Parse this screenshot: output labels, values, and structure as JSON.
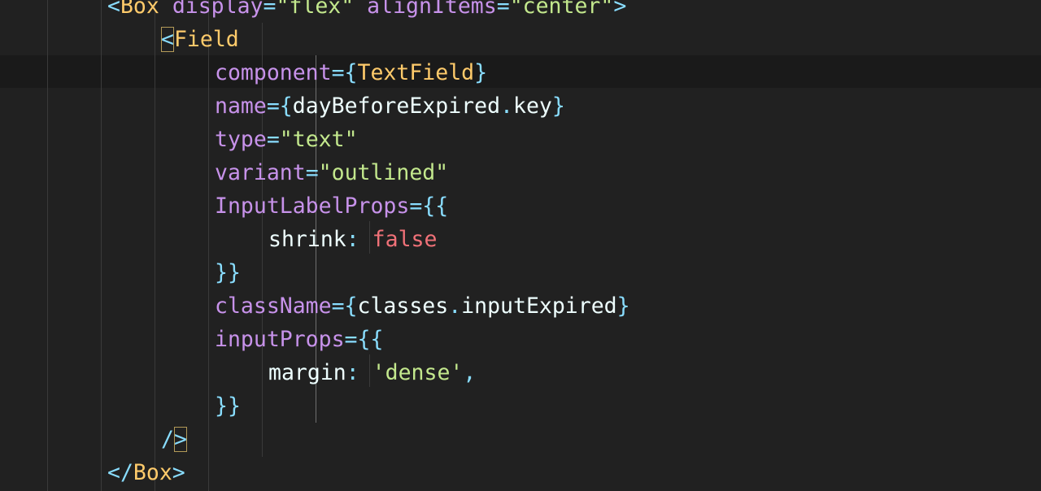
{
  "colors": {
    "background": "#212121",
    "current_line": "#1a1a1a",
    "punctuation": "#89ddff",
    "tag": "#ffcb6b",
    "attribute": "#c792ea",
    "string": "#c3e88d",
    "text": "#eeffff",
    "boolean": "#f07178",
    "indent_guide": "#3a3a3a",
    "bracket_match_border": "#b39a58"
  },
  "code": {
    "lines": [
      {
        "indent": "    ",
        "tokens": [
          {
            "t": "<",
            "k": "punct"
          },
          {
            "t": "Box",
            "k": "tag"
          },
          {
            "t": " ",
            "k": "plain"
          },
          {
            "t": "display",
            "k": "attr"
          },
          {
            "t": "=",
            "k": "punct"
          },
          {
            "t": "\"flex\"",
            "k": "str"
          },
          {
            "t": " ",
            "k": "plain"
          },
          {
            "t": "alignItems",
            "k": "attr"
          },
          {
            "t": "=",
            "k": "punct"
          },
          {
            "t": "\"center\"",
            "k": "str"
          },
          {
            "t": ">",
            "k": "punct"
          }
        ]
      },
      {
        "indent": "      ",
        "tokens": [
          {
            "t": "<",
            "k": "punct",
            "match": true
          },
          {
            "t": "Field",
            "k": "tag"
          }
        ]
      },
      {
        "indent": "        ",
        "highlight": true,
        "tokens": [
          {
            "t": "component",
            "k": "attr"
          },
          {
            "t": "={",
            "k": "punct"
          },
          {
            "t": "TextField",
            "k": "tag"
          },
          {
            "t": "}",
            "k": "punct"
          }
        ]
      },
      {
        "indent": "        ",
        "tokens": [
          {
            "t": "name",
            "k": "attr"
          },
          {
            "t": "={",
            "k": "punct"
          },
          {
            "t": "dayBeforeExpired",
            "k": "plain"
          },
          {
            "t": ".",
            "k": "punct"
          },
          {
            "t": "key",
            "k": "plain"
          },
          {
            "t": "}",
            "k": "punct"
          }
        ]
      },
      {
        "indent": "        ",
        "tokens": [
          {
            "t": "type",
            "k": "attr"
          },
          {
            "t": "=",
            "k": "punct"
          },
          {
            "t": "\"text\"",
            "k": "str"
          }
        ]
      },
      {
        "indent": "        ",
        "tokens": [
          {
            "t": "variant",
            "k": "attr"
          },
          {
            "t": "=",
            "k": "punct"
          },
          {
            "t": "\"outlined\"",
            "k": "str"
          }
        ]
      },
      {
        "indent": "        ",
        "tokens": [
          {
            "t": "InputLabelProps",
            "k": "attr"
          },
          {
            "t": "={{",
            "k": "punct"
          }
        ]
      },
      {
        "indent": "          ",
        "tokens": [
          {
            "t": "shrink",
            "k": "plain"
          },
          {
            "t": ":",
            "k": "punct"
          },
          {
            "t": " ",
            "k": "plain"
          },
          {
            "t": "false",
            "k": "bool"
          }
        ]
      },
      {
        "indent": "        ",
        "tokens": [
          {
            "t": "}}",
            "k": "punct"
          }
        ]
      },
      {
        "indent": "        ",
        "tokens": [
          {
            "t": "className",
            "k": "attr"
          },
          {
            "t": "={",
            "k": "punct"
          },
          {
            "t": "classes",
            "k": "plain"
          },
          {
            "t": ".",
            "k": "punct"
          },
          {
            "t": "inputExpired",
            "k": "plain"
          },
          {
            "t": "}",
            "k": "punct"
          }
        ]
      },
      {
        "indent": "        ",
        "tokens": [
          {
            "t": "inputProps",
            "k": "attr"
          },
          {
            "t": "={{",
            "k": "punct"
          }
        ]
      },
      {
        "indent": "          ",
        "tokens": [
          {
            "t": "margin",
            "k": "plain"
          },
          {
            "t": ":",
            "k": "punct"
          },
          {
            "t": " ",
            "k": "plain"
          },
          {
            "t": "'dense'",
            "k": "str"
          },
          {
            "t": ",",
            "k": "punct"
          }
        ]
      },
      {
        "indent": "        ",
        "tokens": [
          {
            "t": "}}",
            "k": "punct"
          }
        ]
      },
      {
        "indent": "      ",
        "tokens": [
          {
            "t": "/",
            "k": "punct"
          },
          {
            "t": ">",
            "k": "punct",
            "match": true
          }
        ]
      },
      {
        "indent": "    ",
        "tokens": [
          {
            "t": "</",
            "k": "punct"
          },
          {
            "t": "Box",
            "k": "tag"
          },
          {
            "t": ">",
            "k": "punct"
          }
        ]
      }
    ]
  }
}
